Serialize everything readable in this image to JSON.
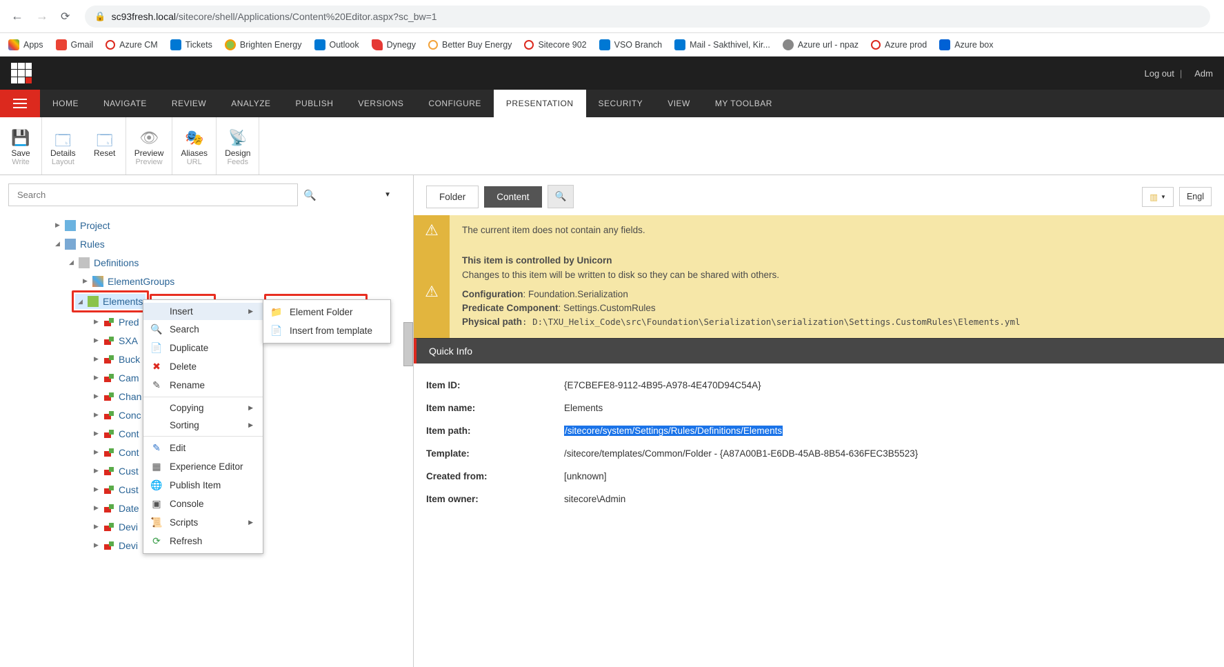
{
  "browser": {
    "host": "sc93fresh.local",
    "path": "/sitecore/shell/Applications/Content%20Editor.aspx?sc_bw=1"
  },
  "bookmarks": [
    {
      "label": "Apps"
    },
    {
      "label": "Gmail"
    },
    {
      "label": "Azure CM"
    },
    {
      "label": "Tickets"
    },
    {
      "label": "Brighten Energy"
    },
    {
      "label": "Outlook"
    },
    {
      "label": "Dynegy"
    },
    {
      "label": "Better Buy Energy"
    },
    {
      "label": "Sitecore 902"
    },
    {
      "label": "VSO Branch"
    },
    {
      "label": "Mail - Sakthivel, Kir..."
    },
    {
      "label": "Azure url - npaz"
    },
    {
      "label": "Azure prod"
    },
    {
      "label": "Azure box"
    }
  ],
  "topnav": {
    "logout": "Log out",
    "user": "Adm"
  },
  "tabs": [
    "HOME",
    "NAVIGATE",
    "REVIEW",
    "ANALYZE",
    "PUBLISH",
    "VERSIONS",
    "CONFIGURE",
    "PRESENTATION",
    "SECURITY",
    "VIEW",
    "MY TOOLBAR"
  ],
  "active_tab": "PRESENTATION",
  "ribbon": {
    "save": {
      "label": "Save",
      "sub": "Write"
    },
    "details": {
      "label": "Details",
      "sub": "Layout"
    },
    "reset": {
      "label": "Reset",
      "sub": ""
    },
    "preview": {
      "label": "Preview",
      "sub": "Preview"
    },
    "aliases": {
      "label": "Aliases",
      "sub": "URL"
    },
    "design": {
      "label": "Design",
      "sub": "Feeds"
    }
  },
  "search": {
    "placeholder": "Search"
  },
  "tree": {
    "project": "Project",
    "rules": "Rules",
    "definitions": "Definitions",
    "elementgroups": "ElementGroups",
    "elements": "Elements",
    "children": [
      "Pred",
      "SXA",
      "Buck",
      "Cam",
      "Chan",
      "Conc",
      "Cont",
      "Cont",
      "Cust",
      "Cust",
      "Date",
      "Devi",
      "Devi"
    ]
  },
  "context_menu": [
    "Insert",
    "Search",
    "Duplicate",
    "Delete",
    "Rename",
    "Copying",
    "Sorting",
    "Edit",
    "Experience Editor",
    "Publish Item",
    "Console",
    "Scripts",
    "Refresh"
  ],
  "submenu": [
    "Element Folder",
    "Insert from template"
  ],
  "content_tabs": {
    "folder": "Folder",
    "content": "Content",
    "lang": "Engl"
  },
  "banners": {
    "nofields": "The current item does not contain any fields.",
    "unicorn_title": "This item is controlled by Unicorn",
    "unicorn_desc": "Changes to this item will be written to disk so they can be shared with others.",
    "config_lbl": "Configuration",
    "config_val": ": Foundation.Serialization",
    "pred_lbl": "Predicate Component",
    "pred_val": ": Settings.CustomRules",
    "phys_lbl": "Physical path",
    "phys_val": ": D:\\TXU_Helix_Code\\src\\Foundation\\Serialization\\serialization\\Settings.CustomRules\\Elements.yml"
  },
  "quickinfo": {
    "title": "Quick Info",
    "rows": [
      {
        "k": "Item ID:",
        "v": "{E7CBEFE8-9112-4B95-A978-4E470D94C54A}"
      },
      {
        "k": "Item name:",
        "v": "Elements"
      },
      {
        "k": "Item path:",
        "v": "/sitecore/system/Settings/Rules/Definitions/Elements",
        "sel": true
      },
      {
        "k": "Template:",
        "v": "/sitecore/templates/Common/Folder - {A87A00B1-E6DB-45AB-8B54-636FEC3B5523}"
      },
      {
        "k": "Created from:",
        "v": "[unknown]"
      },
      {
        "k": "Item owner:",
        "v": "sitecore\\Admin"
      }
    ]
  }
}
